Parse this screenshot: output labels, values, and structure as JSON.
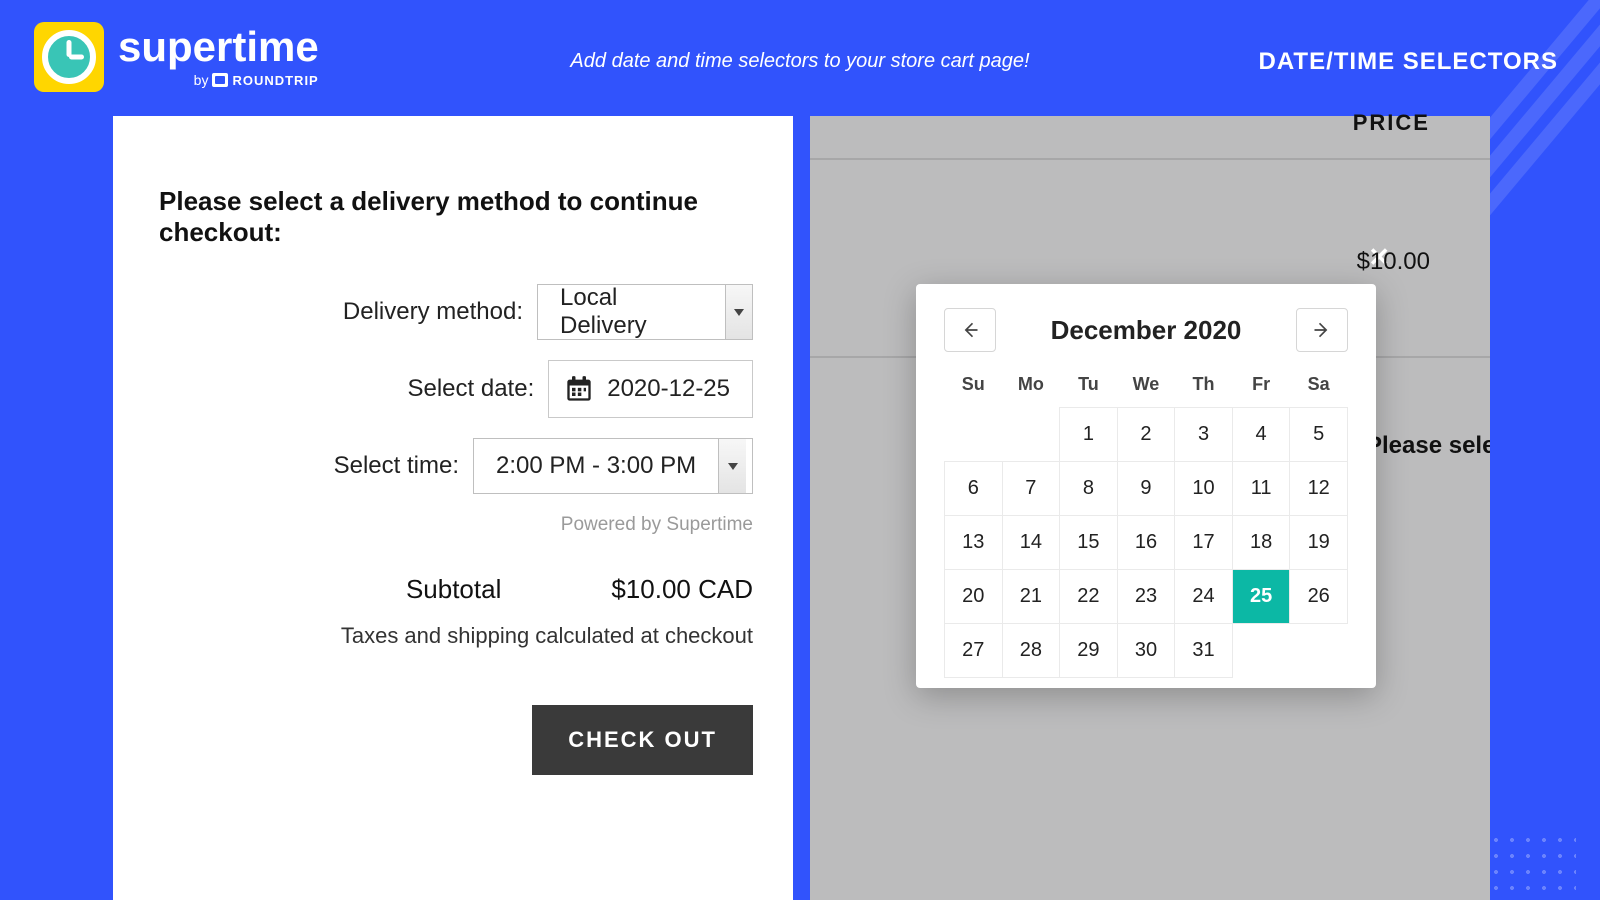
{
  "header": {
    "brand": "supertime",
    "byline_prefix": "by",
    "byline_brand": "ROUNDTRIP",
    "tagline": "Add date and time selectors to your store cart page!",
    "right_label": "DATE/TIME SELECTORS"
  },
  "left": {
    "title": "Please select a delivery method to continue checkout:",
    "delivery_label": "Delivery method:",
    "delivery_value": "Local Delivery",
    "date_label": "Select date:",
    "date_value": "2020-12-25",
    "time_label": "Select time:",
    "time_value": "2:00 PM - 3:00 PM",
    "powered": "Powered by Supertime",
    "subtotal_label": "Subtotal",
    "subtotal_value": "$10.00 CAD",
    "taxes_note": "Taxes and shipping calculated at checkout",
    "checkout": "CHECK OUT"
  },
  "right": {
    "price_header": "PRICE",
    "amount": "$10.00",
    "close": "✕",
    "please": "Please sele"
  },
  "calendar": {
    "month_label": "December 2020",
    "weekdays": [
      "Su",
      "Mo",
      "Tu",
      "We",
      "Th",
      "Fr",
      "Sa"
    ],
    "leading_blanks": 2,
    "days": 31,
    "selected": 25
  }
}
